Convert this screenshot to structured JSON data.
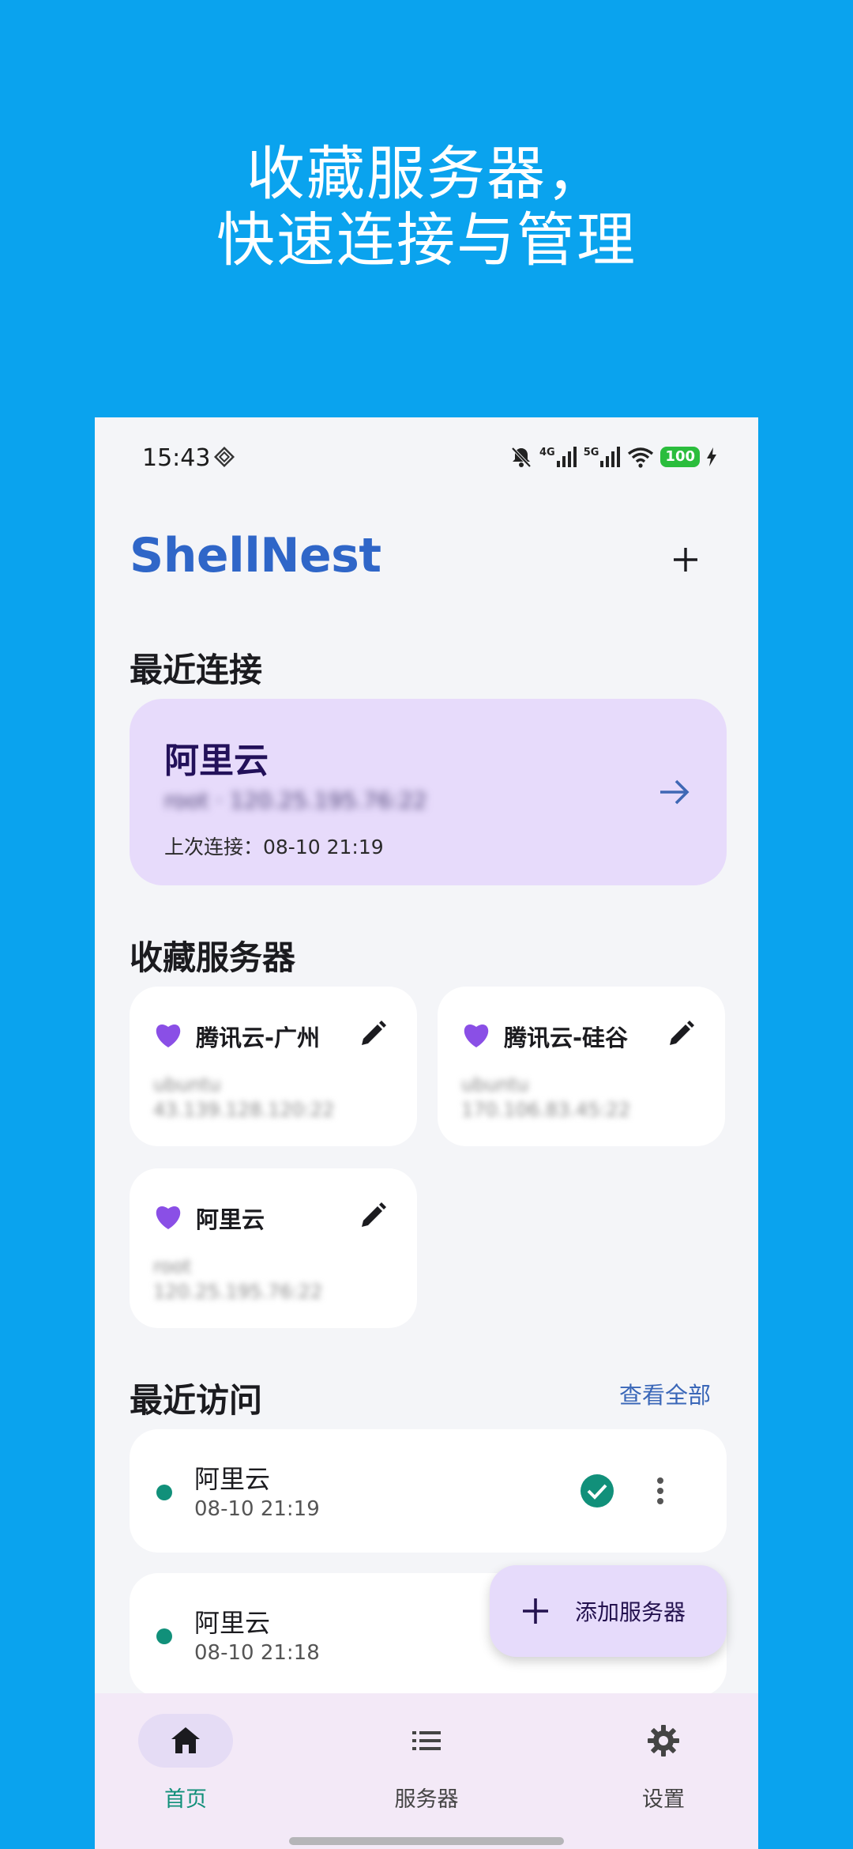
{
  "headline": {
    "line1": "收藏服务器，",
    "line2": "快速连接与管理"
  },
  "status_bar": {
    "time": "15:43",
    "network1": "4G",
    "network2": "5G",
    "battery": "100"
  },
  "app": {
    "title": "ShellNest",
    "add_icon": "plus-icon"
  },
  "recent_connection": {
    "section_title": "最近连接",
    "name": "阿里云",
    "address": "root · 120.25.195.76:22",
    "last_connected": "上次连接：08-10 21:19"
  },
  "favorites": {
    "section_title": "收藏服务器",
    "items": [
      {
        "name": "腾讯云-广州",
        "user": "ubuntu",
        "host": "43.139.128.120:22"
      },
      {
        "name": "腾讯云-硅谷",
        "user": "ubuntu",
        "host": "170.106.83.45:22"
      },
      {
        "name": "阿里云",
        "user": "root",
        "host": "120.25.195.76:22"
      }
    ]
  },
  "recent_visits": {
    "section_title": "最近访问",
    "view_all": "查看全部",
    "items": [
      {
        "name": "阿里云",
        "time": "08-10 21:19",
        "status": "connected"
      },
      {
        "name": "阿里云",
        "time": "08-10 21:18",
        "status": ""
      }
    ]
  },
  "fab": {
    "label": "添加服务器"
  },
  "bottom_nav": {
    "items": [
      {
        "label": "首页",
        "icon": "home-icon",
        "active": true
      },
      {
        "label": "服务器",
        "icon": "list-icon",
        "active": false
      },
      {
        "label": "设置",
        "icon": "gear-icon",
        "active": false
      }
    ]
  },
  "colors": {
    "background": "#0aa3ee",
    "brand": "#2f66c8",
    "card_purple": "#e7dbfb",
    "heart": "#8a4fe6",
    "status_green": "#11907a",
    "nav_active": "#11907a"
  }
}
